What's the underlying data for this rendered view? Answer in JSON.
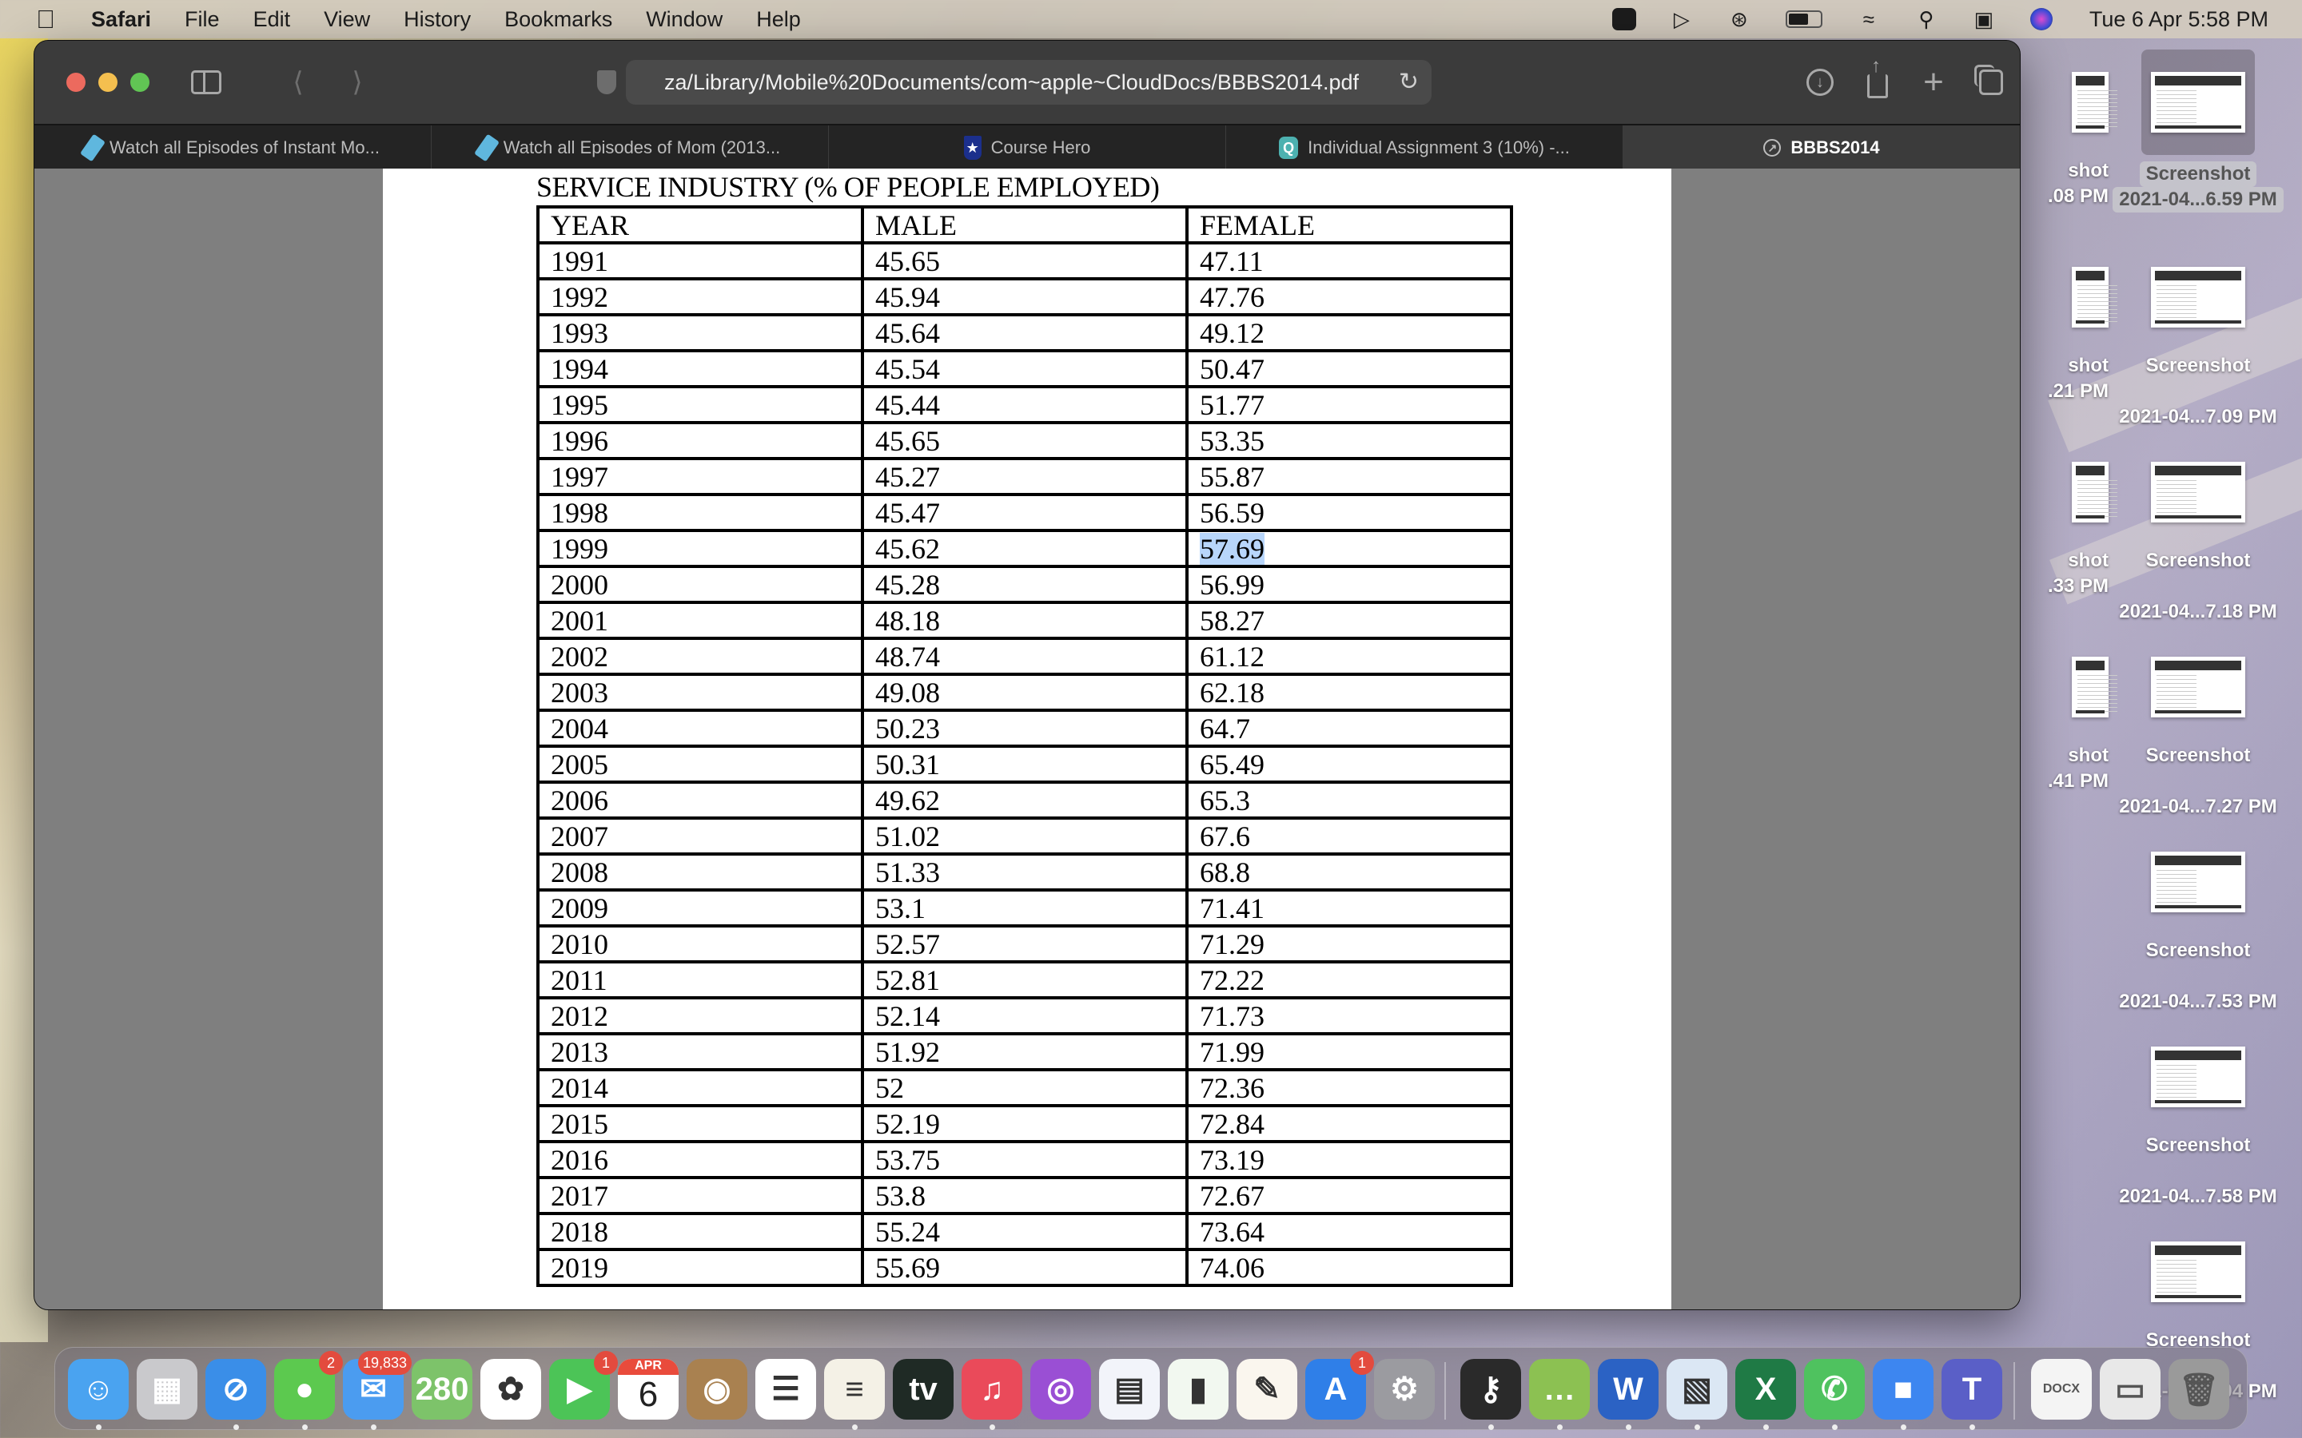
{
  "menubar": {
    "app_name": "Safari",
    "menus": [
      "File",
      "Edit",
      "View",
      "History",
      "Bookmarks",
      "Window",
      "Help"
    ],
    "status_icons": [
      "zoom-icon",
      "play-icon",
      "bluetooth-icon",
      "battery-icon",
      "wifi-icon",
      "spotlight-icon",
      "control-center-icon",
      "siri-icon"
    ],
    "clock": "Tue 6 Apr  5:58 PM"
  },
  "browser": {
    "address": "za/Library/Mobile%20Documents/com~apple~CloudDocs/BBBS2014.pdf",
    "tabs": [
      {
        "label": "Watch all Episodes of Instant Mo...",
        "icon": "ticket-icon",
        "active": false
      },
      {
        "label": "Watch all Episodes of Mom (2013...",
        "icon": "ticket-icon",
        "active": false
      },
      {
        "label": "Course Hero",
        "icon": "course-hero-icon",
        "active": false
      },
      {
        "label": "Individual Assignment 3 (10%) -...",
        "icon": "q-icon",
        "active": false
      },
      {
        "label": "BBBS2014",
        "icon": "compass-icon",
        "active": true
      }
    ]
  },
  "document": {
    "title": "SERVICE INDUSTRY (% OF PEOPLE EMPLOYED)",
    "headers": [
      "YEAR",
      "MALE",
      "FEMALE"
    ],
    "selected_text": "57.69",
    "rows": [
      [
        "1991",
        "45.65",
        "47.11"
      ],
      [
        "1992",
        "45.94",
        "47.76"
      ],
      [
        "1993",
        "45.64",
        "49.12"
      ],
      [
        "1994",
        "45.54",
        "50.47"
      ],
      [
        "1995",
        "45.44",
        "51.77"
      ],
      [
        "1996",
        "45.65",
        "53.35"
      ],
      [
        "1997",
        "45.27",
        "55.87"
      ],
      [
        "1998",
        "45.47",
        "56.59"
      ],
      [
        "1999",
        "45.62",
        "57.69"
      ],
      [
        "2000",
        "45.28",
        "56.99"
      ],
      [
        "2001",
        "48.18",
        "58.27"
      ],
      [
        "2002",
        "48.74",
        "61.12"
      ],
      [
        "2003",
        "49.08",
        "62.18"
      ],
      [
        "2004",
        "50.23",
        "64.7"
      ],
      [
        "2005",
        "50.31",
        "65.49"
      ],
      [
        "2006",
        "49.62",
        "65.3"
      ],
      [
        "2007",
        "51.02",
        "67.6"
      ],
      [
        "2008",
        "51.33",
        "68.8"
      ],
      [
        "2009",
        "53.1",
        "71.41"
      ],
      [
        "2010",
        "52.57",
        "71.29"
      ],
      [
        "2011",
        "52.81",
        "72.22"
      ],
      [
        "2012",
        "52.14",
        "71.73"
      ],
      [
        "2013",
        "51.92",
        "71.99"
      ],
      [
        "2014",
        "52",
        "72.36"
      ],
      [
        "2015",
        "52.19",
        "72.84"
      ],
      [
        "2016",
        "53.75",
        "73.19"
      ],
      [
        "2017",
        "53.8",
        "72.67"
      ],
      [
        "2018",
        "55.24",
        "73.64"
      ],
      [
        "2019",
        "55.69",
        "74.06"
      ]
    ]
  },
  "desktop": {
    "partial_icons": [
      {
        "line1": "shot",
        "line2": ".08 PM"
      },
      {
        "line1": "shot",
        "line2": ".21 PM"
      },
      {
        "line1": "shot",
        "line2": ".33 PM"
      },
      {
        "line1": "shot",
        "line2": ".41 PM"
      }
    ],
    "icons": [
      {
        "line1": "Screenshot",
        "line2": "2021-04...6.59 PM",
        "selected": true
      },
      {
        "line1": "Screenshot",
        "line2": "2021-04...7.09 PM",
        "selected": false
      },
      {
        "line1": "Screenshot",
        "line2": "2021-04...7.18 PM",
        "selected": false
      },
      {
        "line1": "Screenshot",
        "line2": "2021-04...7.27 PM",
        "selected": false
      },
      {
        "line1": "Screenshot",
        "line2": "2021-04...7.53 PM",
        "selected": false
      },
      {
        "line1": "Screenshot",
        "line2": "2021-04...7.58 PM",
        "selected": false
      },
      {
        "line1": "Screenshot",
        "line2": "2021-04...8.04 PM",
        "selected": false
      }
    ]
  },
  "dock": {
    "apps": [
      {
        "name": "Finder",
        "glyph": "☺",
        "color": "#4aa3f0",
        "running": true
      },
      {
        "name": "Launchpad",
        "glyph": "▦",
        "color": "#c9c9cc",
        "running": false
      },
      {
        "name": "Safari",
        "glyph": "⊘",
        "color": "#3a8ee8",
        "running": true
      },
      {
        "name": "Messages",
        "glyph": "●",
        "color": "#5cc94f",
        "running": true,
        "badge": "2"
      },
      {
        "name": "Mail",
        "glyph": "✉",
        "color": "#4b9cf0",
        "running": true,
        "badge": "19,833"
      },
      {
        "name": "Maps",
        "glyph": "280",
        "color": "#7dc36a",
        "running": false
      },
      {
        "name": "Photos",
        "glyph": "✿",
        "color": "#ffffff",
        "running": false
      },
      {
        "name": "FaceTime",
        "glyph": "▶",
        "color": "#4cc457",
        "running": false,
        "badge": "1"
      },
      {
        "name": "Calendar",
        "glyph": "6",
        "color": "#ffffff",
        "running": false,
        "month": "APR"
      },
      {
        "name": "Contacts",
        "glyph": "◉",
        "color": "#a98150",
        "running": false
      },
      {
        "name": "Reminders",
        "glyph": "☰",
        "color": "#ffffff",
        "running": false
      },
      {
        "name": "Notes",
        "glyph": "≡",
        "color": "#f4f1e6",
        "running": true
      },
      {
        "name": "TV",
        "glyph": "tv",
        "color": "#1f2a25",
        "running": false
      },
      {
        "name": "Music",
        "glyph": "♫",
        "color": "#ea4a5a",
        "running": true
      },
      {
        "name": "Podcasts",
        "glyph": "◎",
        "color": "#9a4fd4",
        "running": false
      },
      {
        "name": "Keynote",
        "glyph": "▤",
        "color": "#f2f4fa",
        "running": false
      },
      {
        "name": "Numbers",
        "glyph": "▮",
        "color": "#f2f8f0",
        "running": false
      },
      {
        "name": "Pages",
        "glyph": "✎",
        "color": "#faf6ee",
        "running": false
      },
      {
        "name": "App Store",
        "glyph": "A",
        "color": "#2f7fe8",
        "running": false,
        "badge": "1"
      },
      {
        "name": "System Preferences",
        "glyph": "⚙",
        "color": "#9b9ba0",
        "running": false
      },
      {
        "name": "Keychain Access",
        "glyph": "⚷",
        "color": "#2a2a2a",
        "running": true
      },
      {
        "name": "Speech Bubbles",
        "glyph": "…",
        "color": "#8cc152",
        "running": true
      },
      {
        "name": "Microsoft Word",
        "glyph": "W",
        "color": "#2b62c4",
        "running": true
      },
      {
        "name": "Preview",
        "glyph": "▧",
        "color": "#dbe7f4",
        "running": true
      },
      {
        "name": "Microsoft Excel",
        "glyph": "X",
        "color": "#1f7a45",
        "running": true
      },
      {
        "name": "WhatsApp",
        "glyph": "✆",
        "color": "#4fc25f",
        "running": true
      },
      {
        "name": "Zoom",
        "glyph": "■",
        "color": "#3d86f0",
        "running": true
      },
      {
        "name": "Microsoft Teams",
        "glyph": "T",
        "color": "#5a5fc7",
        "running": true
      }
    ],
    "docs": [
      {
        "name": "DOCX document",
        "glyph": "DOCX",
        "color": "#f4f4f4"
      },
      {
        "name": "Screenshot stack",
        "glyph": "▭",
        "color": "#e8e8e8"
      },
      {
        "name": "Trash",
        "glyph": "🗑",
        "color": "#9a9a9a"
      }
    ]
  }
}
